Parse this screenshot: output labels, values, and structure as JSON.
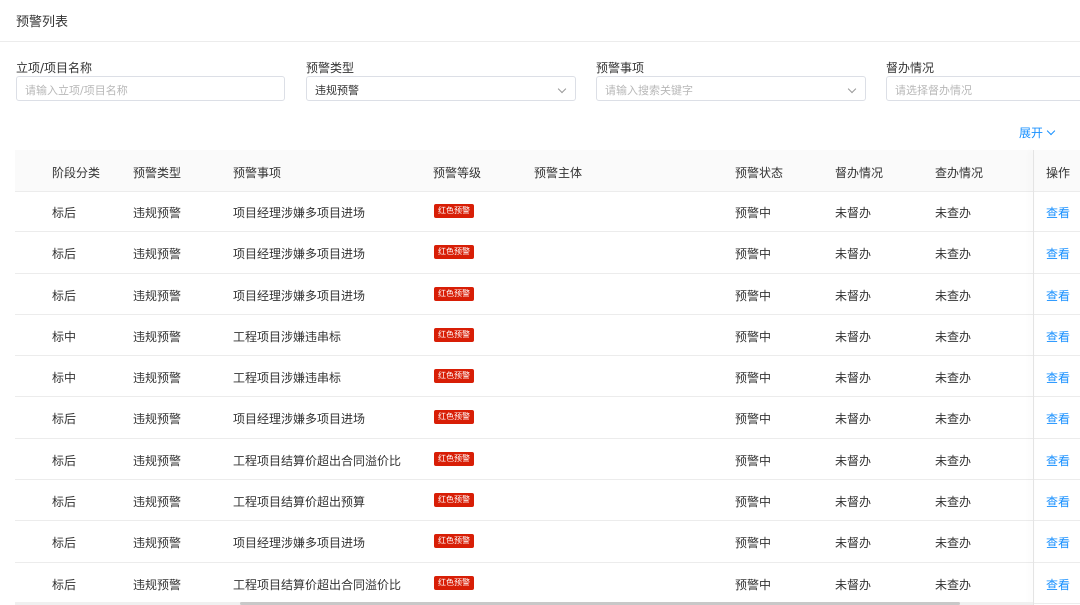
{
  "page_title": "预警列表",
  "filters": {
    "project_name": {
      "label": "立项/项目名称",
      "placeholder": "请输入立项/项目名称"
    },
    "warning_type": {
      "label": "预警类型",
      "value": "违规预警"
    },
    "warning_item": {
      "label": "预警事项",
      "placeholder": "请输入搜索关键字"
    },
    "supervision": {
      "label": "督办情况",
      "placeholder": "请选择督办情况"
    }
  },
  "expand_label": "展开",
  "table": {
    "headers": {
      "stage": "阶段分类",
      "type": "预警类型",
      "item": "预警事项",
      "level": "预警等级",
      "subject": "预警主体",
      "status": "预警状态",
      "supervision": "督办情况",
      "investigation": "查办情况",
      "action": "操作"
    },
    "rows": [
      {
        "stage": "标后",
        "type": "违规预警",
        "item": "项目经理涉嫌多项目进场",
        "level": "红色预警",
        "subject": "",
        "status": "预警中",
        "supervision": "未督办",
        "investigation": "未查办",
        "action": "查看"
      },
      {
        "stage": "标后",
        "type": "违规预警",
        "item": "项目经理涉嫌多项目进场",
        "level": "红色预警",
        "subject": "",
        "status": "预警中",
        "supervision": "未督办",
        "investigation": "未查办",
        "action": "查看"
      },
      {
        "stage": "标后",
        "type": "违规预警",
        "item": "项目经理涉嫌多项目进场",
        "level": "红色预警",
        "subject": "",
        "status": "预警中",
        "supervision": "未督办",
        "investigation": "未查办",
        "action": "查看"
      },
      {
        "stage": "标中",
        "type": "违规预警",
        "item": "工程项目涉嫌违串标",
        "level": "红色预警",
        "subject": "",
        "status": "预警中",
        "supervision": "未督办",
        "investigation": "未查办",
        "action": "查看"
      },
      {
        "stage": "标中",
        "type": "违规预警",
        "item": "工程项目涉嫌违串标",
        "level": "红色预警",
        "subject": "",
        "status": "预警中",
        "supervision": "未督办",
        "investigation": "未查办",
        "action": "查看"
      },
      {
        "stage": "标后",
        "type": "违规预警",
        "item": "项目经理涉嫌多项目进场",
        "level": "红色预警",
        "subject": "",
        "status": "预警中",
        "supervision": "未督办",
        "investigation": "未查办",
        "action": "查看"
      },
      {
        "stage": "标后",
        "type": "违规预警",
        "item": "工程项目结算价超出合同溢价比",
        "level": "红色预警",
        "subject": "",
        "status": "预警中",
        "supervision": "未督办",
        "investigation": "未查办",
        "action": "查看"
      },
      {
        "stage": "标后",
        "type": "违规预警",
        "item": "工程项目结算价超出预算",
        "level": "红色预警",
        "subject": "",
        "status": "预警中",
        "supervision": "未督办",
        "investigation": "未查办",
        "action": "查看"
      },
      {
        "stage": "标后",
        "type": "违规预警",
        "item": "项目经理涉嫌多项目进场",
        "level": "红色预警",
        "subject": "",
        "status": "预警中",
        "supervision": "未督办",
        "investigation": "未查办",
        "action": "查看"
      },
      {
        "stage": "标后",
        "type": "违规预警",
        "item": "工程项目结算价超出合同溢价比",
        "level": "红色预警",
        "subject": "",
        "status": "预警中",
        "supervision": "未督办",
        "investigation": "未查办",
        "action": "查看"
      }
    ]
  },
  "colors": {
    "accent": "#1890ff",
    "danger": "#d81e06",
    "header_bg": "#fafafa",
    "border": "#ececec"
  }
}
